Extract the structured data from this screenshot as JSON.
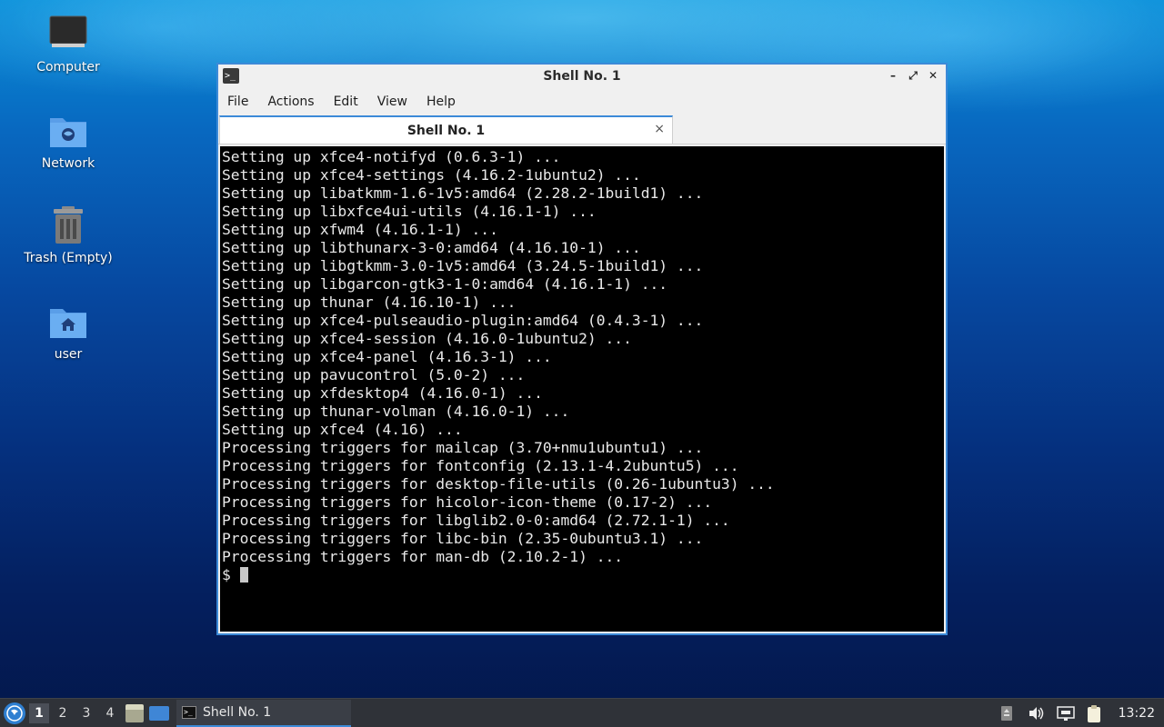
{
  "desktop": {
    "icons": [
      {
        "label": "Computer",
        "icon": "computer-icon"
      },
      {
        "label": "Network",
        "icon": "network-folder-icon"
      },
      {
        "label": "Trash (Empty)",
        "icon": "trash-icon"
      },
      {
        "label": "user",
        "icon": "home-folder-icon"
      }
    ]
  },
  "window": {
    "title": "Shell No. 1",
    "menu": [
      "File",
      "Actions",
      "Edit",
      "View",
      "Help"
    ],
    "tab_label": "Shell No. 1",
    "tab_close": "×"
  },
  "terminal": {
    "lines": [
      "Setting up xfce4-notifyd (0.6.3-1) ...",
      "Setting up xfce4-settings (4.16.2-1ubuntu2) ...",
      "Setting up libatkmm-1.6-1v5:amd64 (2.28.2-1build1) ...",
      "Setting up libxfce4ui-utils (4.16.1-1) ...",
      "Setting up xfwm4 (4.16.1-1) ...",
      "Setting up libthunarx-3-0:amd64 (4.16.10-1) ...",
      "Setting up libgtkmm-3.0-1v5:amd64 (3.24.5-1build1) ...",
      "Setting up libgarcon-gtk3-1-0:amd64 (4.16.1-1) ...",
      "Setting up thunar (4.16.10-1) ...",
      "Setting up xfce4-pulseaudio-plugin:amd64 (0.4.3-1) ...",
      "Setting up xfce4-session (4.16.0-1ubuntu2) ...",
      "Setting up xfce4-panel (4.16.3-1) ...",
      "Setting up pavucontrol (5.0-2) ...",
      "Setting up xfdesktop4 (4.16.0-1) ...",
      "Setting up thunar-volman (4.16.0-1) ...",
      "Setting up xfce4 (4.16) ...",
      "Processing triggers for mailcap (3.70+nmu1ubuntu1) ...",
      "Processing triggers for fontconfig (2.13.1-4.2ubuntu5) ...",
      "Processing triggers for desktop-file-utils (0.26-1ubuntu3) ...",
      "Processing triggers for hicolor-icon-theme (0.17-2) ...",
      "Processing triggers for libglib2.0-0:amd64 (2.72.1-1) ...",
      "Processing triggers for libc-bin (2.35-0ubuntu3.1) ...",
      "Processing triggers for man-db (2.10.2-1) ..."
    ],
    "prompt": "$"
  },
  "taskbar": {
    "workspaces": [
      "1",
      "2",
      "3",
      "4"
    ],
    "active_workspace": "1",
    "task_label": "Shell No. 1",
    "clock": "13:22"
  },
  "colors": {
    "accent": "#3c8ad8",
    "terminal_bg": "#000000",
    "terminal_fg": "#e8e8e8",
    "panel_bg": "#2f3238"
  }
}
